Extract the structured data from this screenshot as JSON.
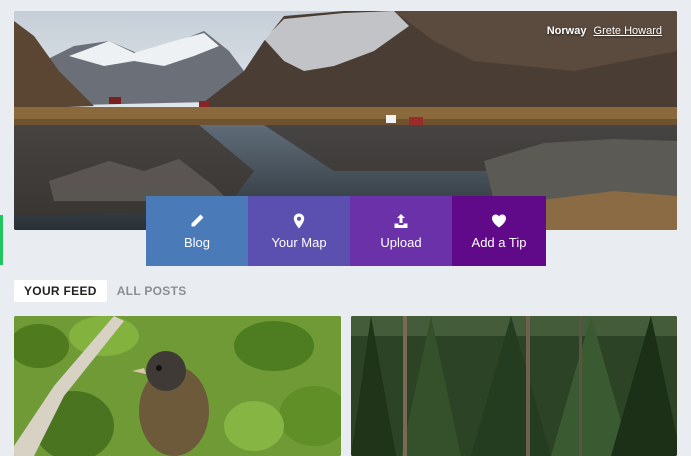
{
  "hero": {
    "location": "Norway",
    "author": "Grete Howard"
  },
  "actions": [
    {
      "label": "Blog",
      "icon": "pencil-icon"
    },
    {
      "label": "Your Map",
      "icon": "map-pin-icon"
    },
    {
      "label": "Upload",
      "icon": "upload-icon"
    },
    {
      "label": "Add a Tip",
      "icon": "heart-icon"
    }
  ],
  "tabs": [
    {
      "label": "YOUR FEED",
      "active": true
    },
    {
      "label": "ALL POSTS",
      "active": false
    }
  ],
  "colors": {
    "blog": "#4a7ab8",
    "map": "#5b4fb0",
    "upload": "#6a31a8",
    "tip": "#600a8a"
  }
}
